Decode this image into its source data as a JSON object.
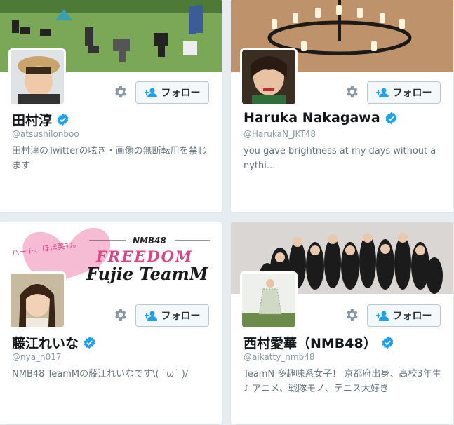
{
  "colors": {
    "accent": "#1da1f2",
    "verified": "#1da1f2",
    "name": "#14171a",
    "handle": "#8899a6",
    "bio": "#66757f"
  },
  "cards": [
    {
      "name": "田村淳",
      "handle": "@atsushilonboo",
      "bio": "田村淳のTwitterの呟き・画像の無断転用を禁じます",
      "follow_label": "フォロー",
      "verified": true,
      "gear_icon": "gear-icon",
      "follow_icon": "add-user-icon"
    },
    {
      "name": "Haruka Nakagawa",
      "handle": "@HarukaN_JKT48",
      "bio": "you gave brightness at my days without anythi...",
      "follow_label": "フォロー",
      "verified": true,
      "gear_icon": "gear-icon",
      "follow_icon": "add-user-icon"
    },
    {
      "name": "藤江れいな",
      "handle": "@nya_n017",
      "bio": "NMB48 TeamMの藤江れいなです\\( ˙ω˙ )/",
      "follow_label": "フォロー",
      "verified": true,
      "gear_icon": "gear-icon",
      "follow_icon": "add-user-icon",
      "banner_text": {
        "top": "NMB48",
        "script": "ハート、ほほ笑む。",
        "line1": "FREEDOM",
        "line2": "Fujie TeamM"
      }
    },
    {
      "name": "西村愛華（NMB48）",
      "handle": "@aikatty_nmb48",
      "bio": "TeamN 多趣味系女子！ 京都府出身、高校3年生♪ アニメ、戦隊モノ、テニス大好き",
      "follow_label": "フォロー",
      "verified": true,
      "gear_icon": "gear-icon",
      "follow_icon": "add-user-icon"
    }
  ]
}
